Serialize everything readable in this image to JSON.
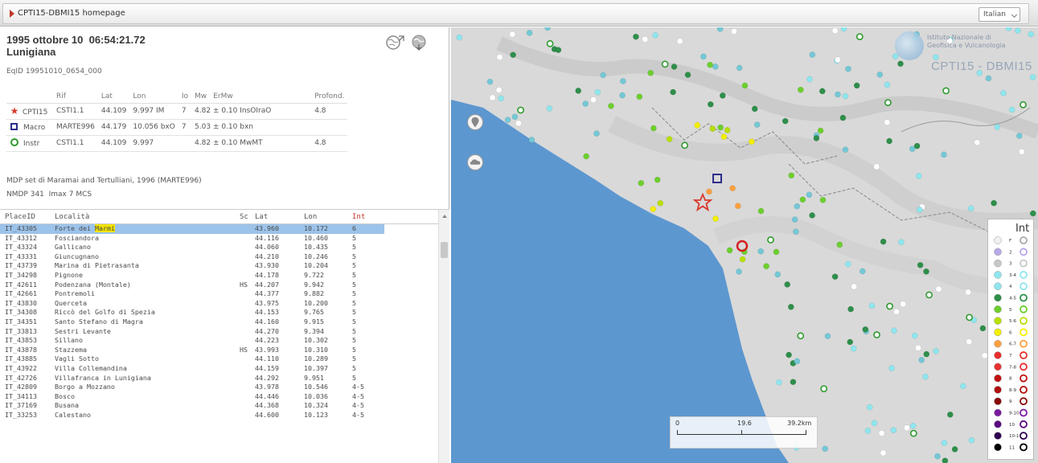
{
  "home_tab": {
    "label": "CPTI15-DBMI15 homepage"
  },
  "language": {
    "selected": "Italian"
  },
  "event": {
    "title_line1": "1995 ottobre 10  06:54:21.72",
    "title_line2": "Lunigiana",
    "eqid": "EqID 19951010_0654_000"
  },
  "params": {
    "headers": [
      "",
      "Rif",
      "Lat",
      "Lon",
      "Io",
      "Mw",
      "ErMw",
      "",
      "Profond."
    ],
    "rows": [
      {
        "marker": "star",
        "name": "CPTI15",
        "rif": "CSTI1.1",
        "lat": "44.109",
        "lon": "9.997 IM",
        "io": "7",
        "mw": "4.82 ± 0.10 InsOIraO",
        "prof": "4.8"
      },
      {
        "marker": "square",
        "name": "Macro",
        "rif": "MARTE996",
        "lat": "44.179",
        "lon": "10.056 bxO",
        "io": "7",
        "mw": "5.03 ± 0.10 bxn",
        "prof": ""
      },
      {
        "marker": "circle",
        "name": "Instr",
        "rif": "CSTI1.1",
        "lat": "44.109",
        "lon": "9.997",
        "io": "",
        "mw": "4.82 ± 0.10 MwMT",
        "prof": "4.8"
      }
    ]
  },
  "mdp": {
    "line1": "MDP set di Maramai and Tertulliani, 1996 (MARTE996)",
    "line2": "NMDP 341  Imax 7 MCS"
  },
  "places": {
    "headers": {
      "id": "PlaceID",
      "loc": "Località",
      "sc": "Sc",
      "lat": "Lat",
      "lon": "Lon",
      "int": "Int"
    },
    "rows": [
      {
        "id": "IT_43305",
        "loc": "Forte dei ",
        "loc_hl": "Marmi",
        "sc": "",
        "lat": "43.960",
        "lon": "10.172",
        "int": "6",
        "selected": true
      },
      {
        "id": "IT_43312",
        "loc": "Fosciandora",
        "sc": "",
        "lat": "44.116",
        "lon": "10.460",
        "int": "5"
      },
      {
        "id": "IT_43324",
        "loc": "Gallicano",
        "sc": "",
        "lat": "44.060",
        "lon": "10.435",
        "int": "5"
      },
      {
        "id": "IT_43331",
        "loc": "Giuncugnano",
        "sc": "",
        "lat": "44.210",
        "lon": "10.246",
        "int": "5"
      },
      {
        "id": "IT_43739",
        "loc": "Marina di Pietrasanta",
        "sc": "",
        "lat": "43.930",
        "lon": "10.204",
        "int": "5"
      },
      {
        "id": "IT_34298",
        "loc": "Pignone",
        "sc": "",
        "lat": "44.178",
        "lon": "9.722",
        "int": "5"
      },
      {
        "id": "IT_42611",
        "loc": "Podenzana (Montale)",
        "sc": "HS",
        "lat": "44.207",
        "lon": "9.942",
        "int": "5"
      },
      {
        "id": "IT_42661",
        "loc": "Pontremoli",
        "sc": "",
        "lat": "44.377",
        "lon": "9.882",
        "int": "5"
      },
      {
        "id": "IT_43830",
        "loc": "Querceta",
        "sc": "",
        "lat": "43.975",
        "lon": "10.200",
        "int": "5"
      },
      {
        "id": "IT_34308",
        "loc": "Riccò del Golfo di Spezia",
        "sc": "",
        "lat": "44.153",
        "lon": "9.765",
        "int": "5"
      },
      {
        "id": "IT_34351",
        "loc": "Santo Stefano di Magra",
        "sc": "",
        "lat": "44.160",
        "lon": "9.915",
        "int": "5"
      },
      {
        "id": "IT_33813",
        "loc": "Sestri Levante",
        "sc": "",
        "lat": "44.270",
        "lon": "9.394",
        "int": "5"
      },
      {
        "id": "IT_43853",
        "loc": "Sillano",
        "sc": "",
        "lat": "44.223",
        "lon": "10.302",
        "int": "5"
      },
      {
        "id": "IT_43878",
        "loc": "Stazzema",
        "sc": "HS",
        "lat": "43.993",
        "lon": "10.310",
        "int": "5"
      },
      {
        "id": "IT_43885",
        "loc": "Vagli Sotto",
        "sc": "",
        "lat": "44.110",
        "lon": "10.289",
        "int": "5"
      },
      {
        "id": "IT_43922",
        "loc": "Villa Collemandina",
        "sc": "",
        "lat": "44.159",
        "lon": "10.397",
        "int": "5"
      },
      {
        "id": "IT_42726",
        "loc": "Villafranca in Lunigiana",
        "sc": "",
        "lat": "44.292",
        "lon": "9.951",
        "int": "5"
      },
      {
        "id": "IT_42809",
        "loc": "Borgo a Mozzano",
        "sc": "",
        "lat": "43.978",
        "lon": "10.546",
        "int": "4-5"
      },
      {
        "id": "IT_34113",
        "loc": "Bosco",
        "sc": "",
        "lat": "44.446",
        "lon": "10.036",
        "int": "4-5"
      },
      {
        "id": "IT_37169",
        "loc": "Busana",
        "sc": "",
        "lat": "44.368",
        "lon": "10.324",
        "int": "4-5"
      },
      {
        "id": "IT_33253",
        "loc": "Calestano",
        "sc": "",
        "lat": "44.600",
        "lon": "10.123",
        "int": "4-5"
      }
    ]
  },
  "map": {
    "brand": "CPTI15 - DBMI15",
    "institute_line1": "Istituto Nazionale di",
    "institute_line2": "Geofisica e Vulcanologia",
    "scale_labels": [
      "0",
      "19.6",
      "39.2km"
    ],
    "legend_title": "Int",
    "legend_labels": [
      "F",
      "2",
      "3",
      "3-4",
      "4",
      "4-5",
      "5",
      "5-6",
      "6",
      "6-7",
      "7",
      "7-8",
      "8",
      "8-9",
      "9",
      "9-10",
      "10",
      "10-11",
      "11"
    ],
    "colors": {
      "selection": "#9cc3ea",
      "highlight": "#f2e200",
      "sea": "#5d97cf",
      "epicenter_star": "#d93a2b"
    }
  }
}
